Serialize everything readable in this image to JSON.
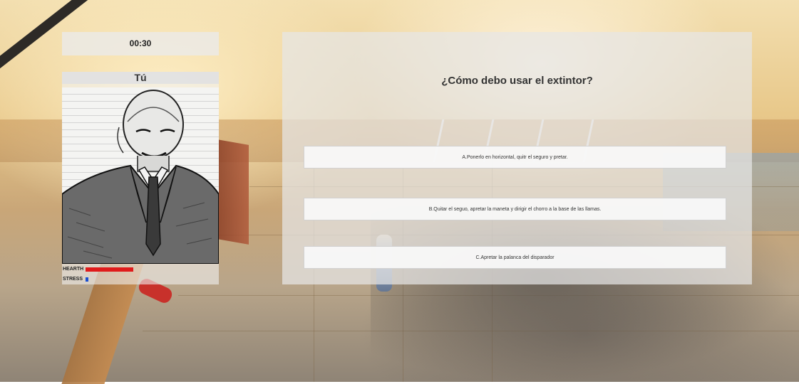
{
  "hud": {
    "timer": "00:30",
    "player": {
      "name": "Tú",
      "stats": [
        {
          "label": "HEARTH",
          "value": 0.36,
          "color": "#e01b1b"
        },
        {
          "label": "STRESS",
          "value": 0.02,
          "color": "#1a4fd1"
        }
      ]
    }
  },
  "question": {
    "text": "¿Cómo debo usar el extintor?",
    "answers": [
      {
        "label": "A.Ponerlo en horizontal, quitr el seguro y pretar."
      },
      {
        "label": "B.Quitar el seguo, apretar la maneta y dirigir el chorro a la base de las llamas."
      },
      {
        "label": "C.Apretar la palanca del disparador"
      }
    ]
  },
  "colors": {
    "panel": "#e6e6e6",
    "answer_bg": "#f8f8f8",
    "health": "#e01b1b",
    "stress": "#1a4fd1"
  },
  "icons": {
    "portrait": "player-sketch-portrait",
    "extinguisher": "fire-extinguisher"
  }
}
